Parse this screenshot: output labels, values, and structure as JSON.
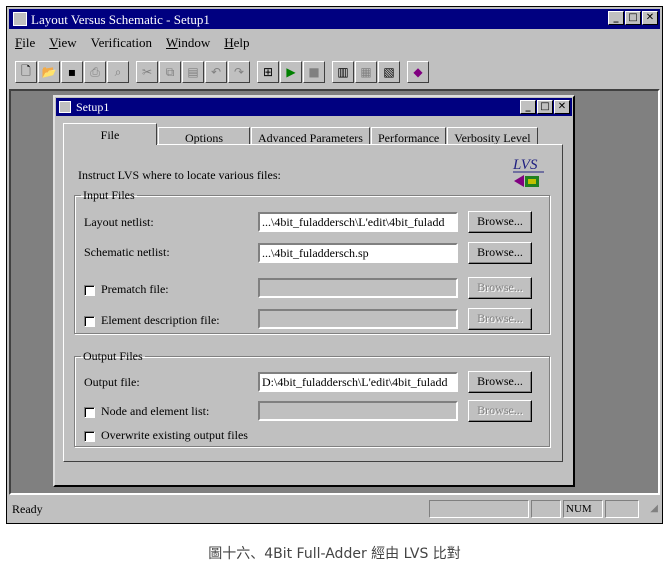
{
  "app": {
    "title": "Layout Versus Schematic - Setup1"
  },
  "menu": [
    {
      "first": "F",
      "rest": "ile"
    },
    {
      "first": "V",
      "rest": "iew"
    },
    {
      "first": "Ve",
      "rest": "rification"
    },
    {
      "first": "W",
      "rest": "indow"
    },
    {
      "first": "H",
      "rest": "elp"
    }
  ],
  "toolbar": {
    "icons": [
      "new-icon",
      "open-icon",
      "save-icon",
      "print-icon",
      "preview-icon",
      "cut-icon",
      "copy-icon",
      "paste-icon",
      "undo-icon",
      "redo-icon",
      "find-icon",
      "run-icon",
      "stop-icon",
      "chart-icon",
      "chart2-icon",
      "chart3-icon",
      "help-book-icon"
    ]
  },
  "setup": {
    "title": "Setup1",
    "tabs": [
      "File",
      "Options",
      "Advanced Parameters",
      "Performance",
      "Verbosity Level"
    ],
    "active_tab": "File",
    "instruction": "Instruct LVS where to locate various files:",
    "logo_text": "LVS",
    "input_files": {
      "legend": "Input Files",
      "layout_label": "Layout netlist:",
      "layout_value": "...\\4bit_fuladdersch\\L'edit\\4bit_fuladd",
      "schematic_label": "Schematic netlist:",
      "schematic_value": "...\\4bit_fuladdersch.sp",
      "prematch_label": "Prematch file:",
      "element_label": "Element description file:"
    },
    "output_files": {
      "legend": "Output Files",
      "output_label": "Output file:",
      "output_value": "D:\\4bit_fuladdersch\\L'edit\\4bit_fuladd",
      "node_label": "Node and element list:",
      "overwrite_label": "Overwrite existing output files"
    },
    "browse_label": "Browse..."
  },
  "status": {
    "text": "Ready",
    "num": "NUM"
  },
  "caption": "圖十六、4Bit Full-Adder 經由 LVS 比對"
}
